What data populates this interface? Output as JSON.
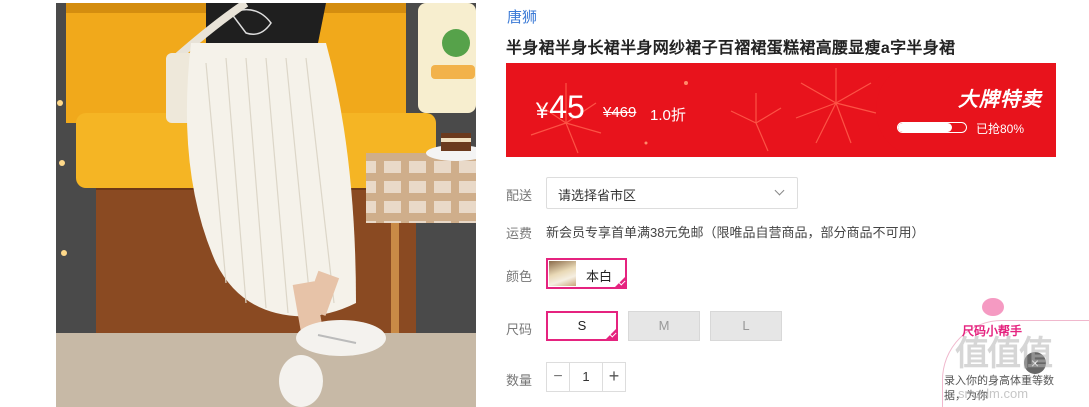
{
  "product": {
    "brand": "唐狮",
    "title": "半身裙半身长裙半身网纱裙子百褶裙蛋糕裙高腰显瘦a字半身裙"
  },
  "promo": {
    "currency": "¥",
    "price": "45",
    "original_price": "¥469",
    "discount": "1.0折",
    "tag": "大牌特卖",
    "sold_text": "已抢80%",
    "sold_fraction": 0.8,
    "color": "#e8131c"
  },
  "delivery": {
    "label": "配送",
    "placeholder_value": "请选择省市区"
  },
  "shipping": {
    "label": "运费",
    "text": "新会员专享首单满38元免邮（限唯品自营商品，部分商品不可用）"
  },
  "color_option": {
    "label": "颜色",
    "options": [
      {
        "name": "本白",
        "selected": true
      }
    ]
  },
  "size_option": {
    "label": "尺码",
    "options": [
      {
        "name": "S",
        "state": "selected"
      },
      {
        "name": "M",
        "state": "disabled"
      },
      {
        "name": "L",
        "state": "disabled"
      }
    ]
  },
  "quantity": {
    "label": "数量",
    "value": "1",
    "minus": "−",
    "plus": "+"
  },
  "helper": {
    "title": "尺码小帮手",
    "text": "录入你的身高体重等数据，为你"
  },
  "watermark": {
    "text": "值值值",
    "sub": "smzdm.com"
  },
  "accent_color": "#e5237f",
  "link_color": "#3b7ad6"
}
